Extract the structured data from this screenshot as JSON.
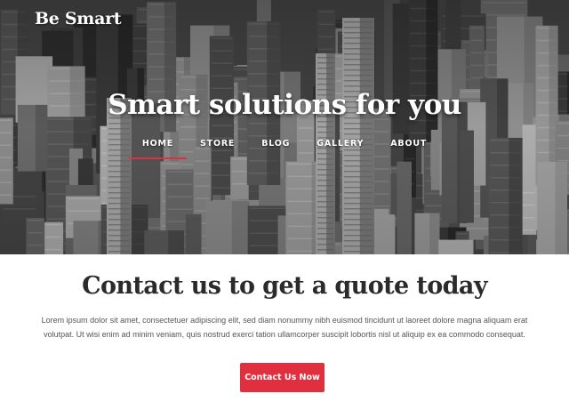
{
  "site": {
    "logo_text": "Be Smart"
  },
  "hero": {
    "title": "Smart solutions for you"
  },
  "nav": {
    "items": [
      {
        "label": "HOME",
        "active": true
      },
      {
        "label": "STORE",
        "active": false
      },
      {
        "label": "BLOG",
        "active": false
      },
      {
        "label": "GALLERY",
        "active": false
      },
      {
        "label": "ABOUT",
        "active": false
      }
    ]
  },
  "cta": {
    "title": "Contact us to get a quote today",
    "text": "Lorem ipsum dolor sit amet, consectetuer adipiscing elit, sed diam nonummy nibh euismod tincidunt ut laoreet dolore magna aliquam erat volutpat. Ut wisi enim ad minim veniam, quis nostrud exerci tation ullamcorper suscipit lobortis nisl ut aliquip ex ea commodo consequat.",
    "button_label": "Contact Us Now"
  },
  "colors": {
    "accent": "#e0303f",
    "heading_text": "#2b2b2b",
    "body_text": "#555555",
    "hero_overlay_text": "#ffffff"
  },
  "icons": []
}
